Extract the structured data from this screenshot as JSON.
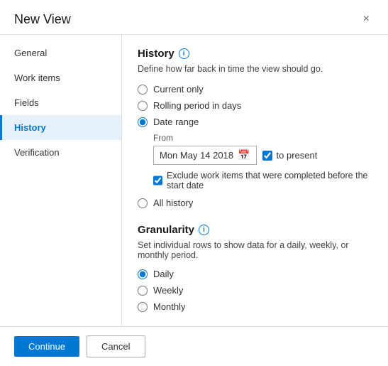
{
  "dialog": {
    "title": "New View",
    "close_icon": "×"
  },
  "sidebar": {
    "items": [
      {
        "label": "General",
        "id": "general",
        "active": false
      },
      {
        "label": "Work items",
        "id": "work-items",
        "active": false
      },
      {
        "label": "Fields",
        "id": "fields",
        "active": false
      },
      {
        "label": "History",
        "id": "history",
        "active": true
      },
      {
        "label": "Verification",
        "id": "verification",
        "active": false
      }
    ]
  },
  "main": {
    "section_title": "History",
    "section_desc": "Define how far back in time the view should go.",
    "options": [
      {
        "label": "Current only",
        "value": "current-only",
        "checked": false
      },
      {
        "label": "Rolling period in days",
        "value": "rolling-period",
        "checked": false
      },
      {
        "label": "Date range",
        "value": "date-range",
        "checked": true
      }
    ],
    "from_label": "From",
    "date_value": "Mon May 14 2018",
    "to_present_label": "to present",
    "exclude_label": "Exclude work items that were completed before the start date",
    "all_history_label": "All history",
    "granularity": {
      "title": "Granularity",
      "desc": "Set individual rows to show data for a daily, weekly, or monthly period.",
      "options": [
        {
          "label": "Daily",
          "value": "daily",
          "checked": true
        },
        {
          "label": "Weekly",
          "value": "weekly",
          "checked": false
        },
        {
          "label": "Monthly",
          "value": "monthly",
          "checked": false
        }
      ]
    }
  },
  "footer": {
    "continue_label": "Continue",
    "cancel_label": "Cancel"
  }
}
